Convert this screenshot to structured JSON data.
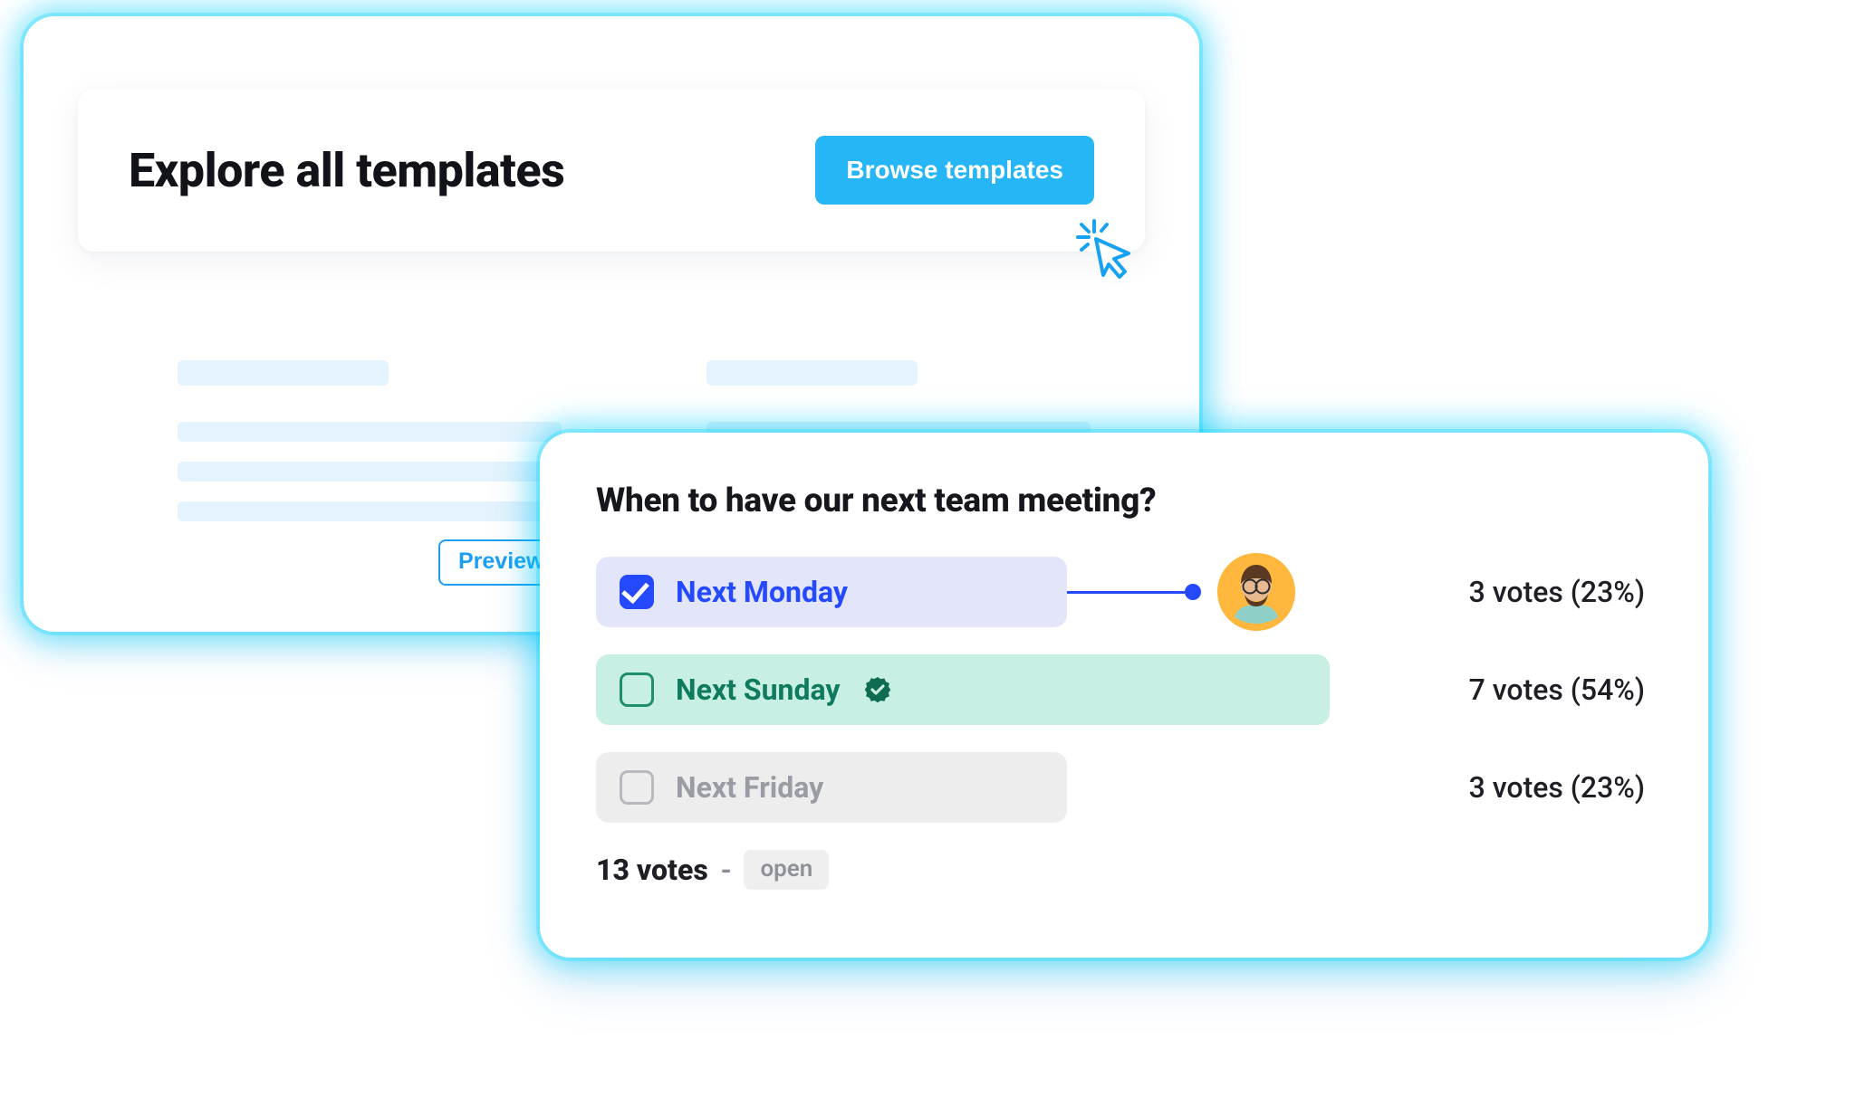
{
  "templates": {
    "title": "Explore all templates",
    "browse_label": "Browse templates",
    "preview_label": "Preview"
  },
  "poll": {
    "question": "When to have our next team meeting?",
    "options": [
      {
        "label": "Next Monday",
        "votes_text": "3 votes (23%)",
        "selected": true
      },
      {
        "label": "Next Sunday",
        "votes_text": "7 votes (54%)",
        "winner": true
      },
      {
        "label": "Next Friday",
        "votes_text": "3 votes (23%)"
      }
    ],
    "total_text": "13 votes",
    "status": "open"
  }
}
